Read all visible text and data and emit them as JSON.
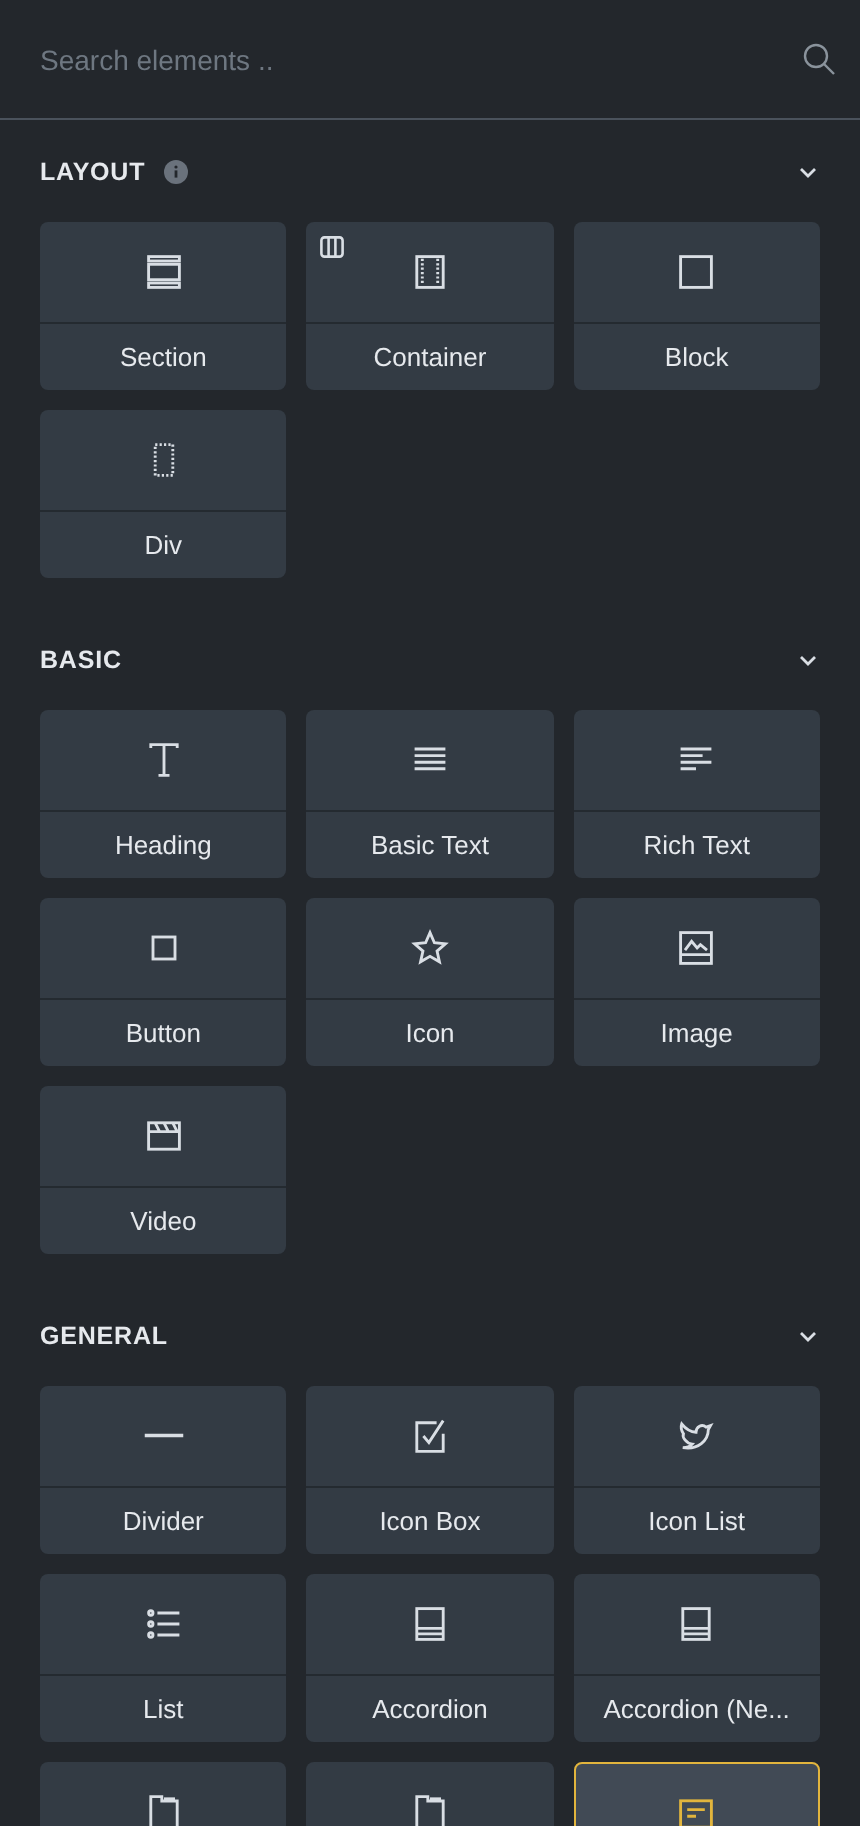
{
  "search": {
    "placeholder": "Search elements .."
  },
  "categories": [
    {
      "title": "LAYOUT",
      "info": true,
      "expanded": true,
      "items": [
        {
          "label": "Section",
          "kind": "section",
          "badge": false,
          "selected": false
        },
        {
          "label": "Container",
          "kind": "container",
          "badge": true,
          "selected": false
        },
        {
          "label": "Block",
          "kind": "block",
          "badge": false,
          "selected": false
        },
        {
          "label": "Div",
          "kind": "div",
          "badge": false,
          "selected": false
        }
      ]
    },
    {
      "title": "BASIC",
      "info": false,
      "expanded": true,
      "items": [
        {
          "label": "Heading",
          "kind": "heading",
          "badge": false,
          "selected": false
        },
        {
          "label": "Basic Text",
          "kind": "basictext",
          "badge": false,
          "selected": false
        },
        {
          "label": "Rich Text",
          "kind": "richtext",
          "badge": false,
          "selected": false
        },
        {
          "label": "Button",
          "kind": "button",
          "badge": false,
          "selected": false
        },
        {
          "label": "Icon",
          "kind": "star",
          "badge": false,
          "selected": false
        },
        {
          "label": "Image",
          "kind": "image",
          "badge": false,
          "selected": false
        },
        {
          "label": "Video",
          "kind": "video",
          "badge": false,
          "selected": false
        }
      ]
    },
    {
      "title": "GENERAL",
      "info": false,
      "expanded": true,
      "items": [
        {
          "label": "Divider",
          "kind": "divider",
          "badge": false,
          "selected": false
        },
        {
          "label": "Icon Box",
          "kind": "iconbox",
          "badge": false,
          "selected": false
        },
        {
          "label": "Icon List",
          "kind": "bird",
          "badge": false,
          "selected": false
        },
        {
          "label": "List",
          "kind": "list",
          "badge": false,
          "selected": false
        },
        {
          "label": "Accordion",
          "kind": "accordion",
          "badge": false,
          "selected": false
        },
        {
          "label": "Accordion (Ne...",
          "kind": "accordion",
          "badge": false,
          "selected": false
        },
        {
          "kind": "tabs",
          "badge": false,
          "selected": false
        },
        {
          "kind": "tabs",
          "badge": false,
          "selected": false
        },
        {
          "kind": "alert",
          "badge": false,
          "selected": true
        }
      ]
    }
  ]
}
